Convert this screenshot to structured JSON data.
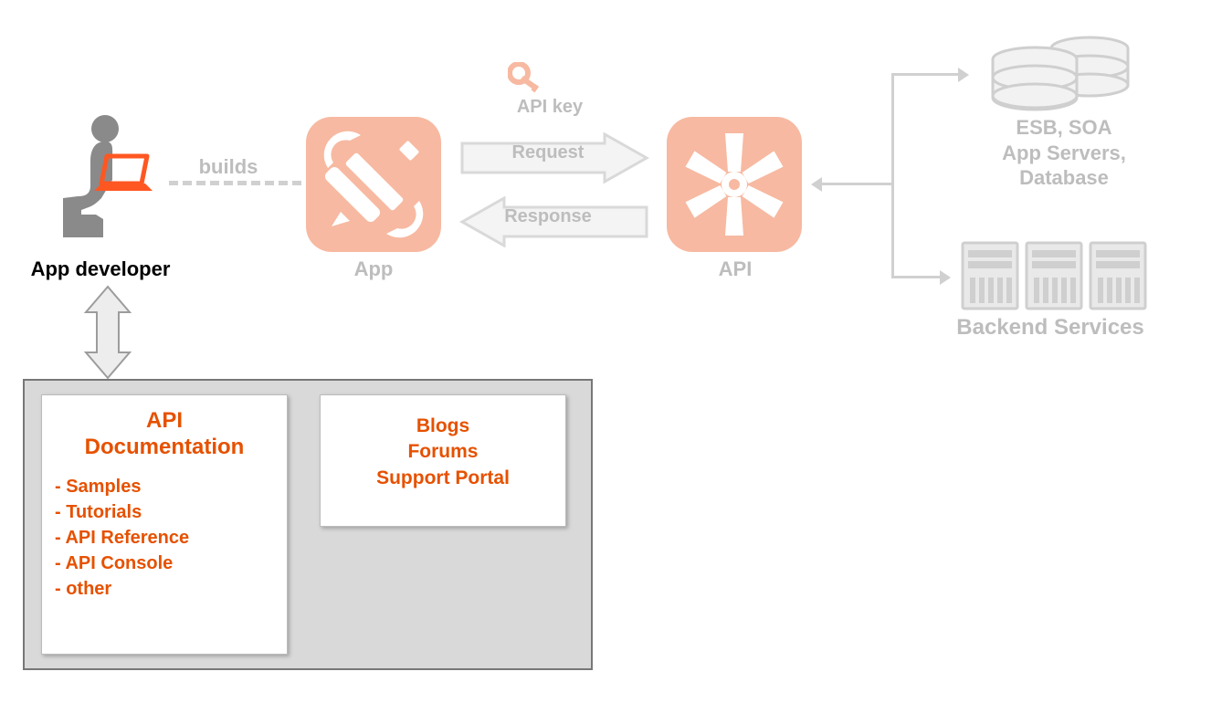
{
  "developer": {
    "label": "App developer"
  },
  "builds": {
    "label": "builds"
  },
  "app": {
    "label": "App"
  },
  "apikey": {
    "label": "API key"
  },
  "request": {
    "label": "Request"
  },
  "response": {
    "label": "Response"
  },
  "api": {
    "label": "API"
  },
  "db": {
    "label_line1": "ESB, SOA",
    "label_line2": "App Servers,",
    "label_line3": "Database"
  },
  "backend": {
    "label": "Backend Services"
  },
  "docs": {
    "title_line1": "API",
    "title_line2": "Documentation",
    "items": [
      "- Samples",
      "- Tutorials",
      "- API Reference",
      "- API Console",
      "- other"
    ]
  },
  "community": {
    "items": [
      "Blogs",
      "Forums",
      "Support Portal"
    ]
  }
}
